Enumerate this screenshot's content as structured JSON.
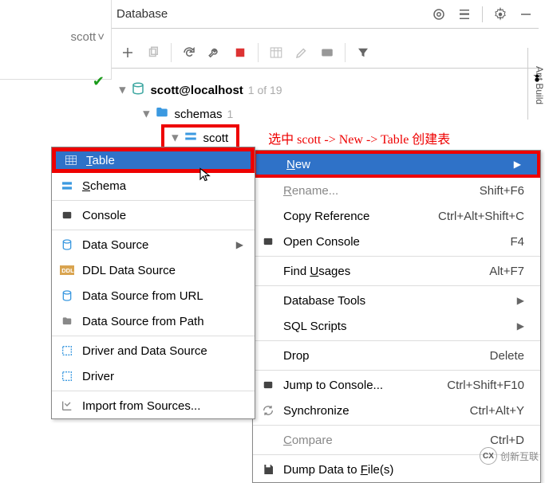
{
  "header": {
    "title": "Database"
  },
  "leftstrip": {
    "user": "scott"
  },
  "tree": {
    "datasource": "scott@localhost",
    "ds_count": "1 of 19",
    "schemas_label": "schemas",
    "schemas_count": "1",
    "selected_schema": "scott",
    "annotation": "选中 scott -> New -> Table 创建表"
  },
  "sidepanel": {
    "label": "Ant Build"
  },
  "leftmenu": {
    "items": [
      {
        "label": "Table",
        "underline": "T",
        "rest": "able",
        "icon": "table",
        "selected": true
      },
      {
        "label": "Schema",
        "underline": "S",
        "rest": "chema",
        "icon": "schema"
      },
      {
        "label": "Console",
        "underline": "",
        "rest": "Console",
        "icon": "console"
      },
      {
        "label": "Data Source",
        "underline": "",
        "rest": "Data Source",
        "icon": "datasource",
        "arrow": true
      },
      {
        "label": "DDL Data Source",
        "underline": "",
        "rest": "DDL Data Source",
        "icon": "ddl"
      },
      {
        "label": "Data Source from URL",
        "underline": "",
        "rest": "Data Source from URL",
        "icon": "url"
      },
      {
        "label": "Data Source from Path",
        "underline": "",
        "rest": "Data Source from Path",
        "icon": "path"
      },
      {
        "label": "Driver and Data Source",
        "underline": "",
        "rest": "Driver and Data Source",
        "icon": "driver"
      },
      {
        "label": "Driver",
        "underline": "",
        "rest": "Driver",
        "icon": "driver"
      },
      {
        "label": "Import from Sources...",
        "underline": "",
        "rest": "Import from Sources...",
        "icon": "import"
      }
    ]
  },
  "rightmenu": {
    "items": [
      {
        "label": "New",
        "underline": "N",
        "rest": "ew",
        "selected": true,
        "arrow": true
      },
      {
        "label": "Rename...",
        "underline": "R",
        "rest": "ename...",
        "disabled": true,
        "shortcut": "Shift+F6"
      },
      {
        "label": "Copy Reference",
        "shortcut": "Ctrl+Alt+Shift+C"
      },
      {
        "label": "Open Console",
        "shortcut": "F4",
        "icon": "console"
      },
      {
        "label": "Find Usages",
        "underline": "U",
        "rest": "sages",
        "prefix": "Find ",
        "shortcut": "Alt+F7"
      },
      {
        "label": "Database Tools",
        "arrow": true
      },
      {
        "label": "SQL Scripts",
        "arrow": true
      },
      {
        "label": "Drop",
        "shortcut": "Delete"
      },
      {
        "label": "Jump to Console...",
        "shortcut": "Ctrl+Shift+F10",
        "icon": "console"
      },
      {
        "label": "Synchronize",
        "shortcut": "Ctrl+Alt+Y",
        "icon": "sync"
      },
      {
        "label": "Compare",
        "underline": "C",
        "rest": "ompare",
        "disabled": true,
        "shortcut": "Ctrl+D"
      },
      {
        "label": "Dump Data to File(s)",
        "underline": "F",
        "prefix": "Dump Data to ",
        "rest": "ile(s)",
        "icon": "save"
      }
    ]
  },
  "watermark": {
    "text": "创新互联"
  }
}
